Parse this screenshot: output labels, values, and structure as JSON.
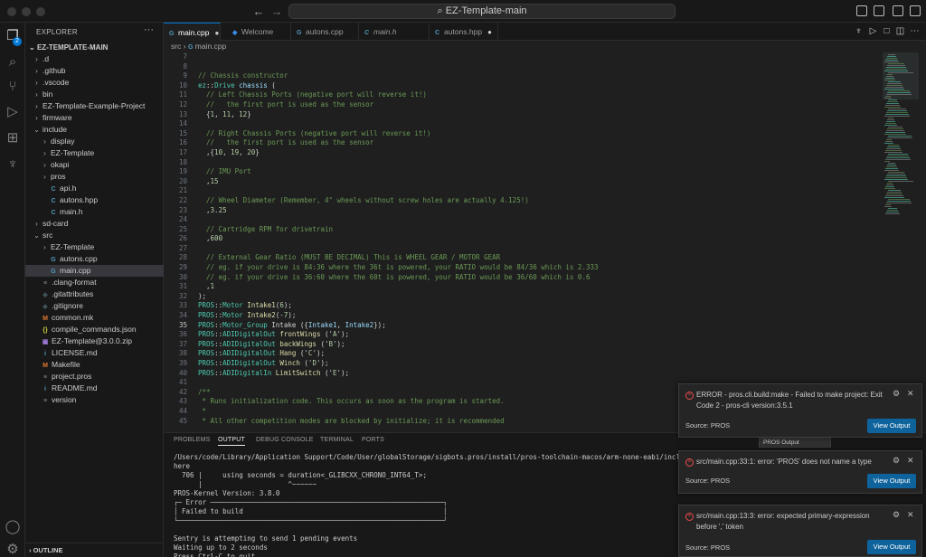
{
  "titlebar": {
    "search": "EZ-Template-main",
    "back": "←",
    "forward": "→"
  },
  "activity": {
    "badge": "2"
  },
  "sidebar": {
    "title": "EXPLORER",
    "more": "···",
    "root": "EZ-TEMPLATE-MAIN",
    "items": [
      {
        "label": ".d",
        "chev": "›",
        "icon": "",
        "depth": 0
      },
      {
        "label": ".github",
        "chev": "›",
        "icon": "",
        "depth": 0
      },
      {
        "label": ".vscode",
        "chev": "›",
        "icon": "",
        "depth": 0
      },
      {
        "label": "bin",
        "chev": "›",
        "icon": "",
        "depth": 0
      },
      {
        "label": "EZ-Template-Example-Project",
        "chev": "›",
        "icon": "",
        "depth": 0
      },
      {
        "label": "firmware",
        "chev": "›",
        "icon": "",
        "depth": 0
      },
      {
        "label": "include",
        "chev": "⌄",
        "icon": "",
        "depth": 0
      },
      {
        "label": "display",
        "chev": "›",
        "icon": "",
        "depth": 1
      },
      {
        "label": "EZ-Template",
        "chev": "›",
        "icon": "",
        "depth": 1
      },
      {
        "label": "okapi",
        "chev": "›",
        "icon": "",
        "depth": 1
      },
      {
        "label": "pros",
        "chev": "›",
        "icon": "",
        "depth": 1
      },
      {
        "label": "api.h",
        "chev": "",
        "icon": "C",
        "depth": 1
      },
      {
        "label": "autons.hpp",
        "chev": "",
        "icon": "C",
        "depth": 1
      },
      {
        "label": "main.h",
        "chev": "",
        "icon": "C",
        "depth": 1
      },
      {
        "label": "sd-card",
        "chev": "›",
        "icon": "",
        "depth": 0
      },
      {
        "label": "src",
        "chev": "⌄",
        "icon": "",
        "depth": 0
      },
      {
        "label": "EZ-Template",
        "chev": "›",
        "icon": "",
        "depth": 1
      },
      {
        "label": "autons.cpp",
        "chev": "",
        "icon": "G",
        "depth": 1
      },
      {
        "label": "main.cpp",
        "chev": "",
        "icon": "G",
        "depth": 1
      },
      {
        "label": ".clang-format",
        "chev": "",
        "icon": "≡",
        "depth": 0
      },
      {
        "label": ".gitattributes",
        "chev": "",
        "icon": "◆",
        "depth": 0
      },
      {
        "label": ".gitignore",
        "chev": "",
        "icon": "◆",
        "depth": 0
      },
      {
        "label": "common.mk",
        "chev": "",
        "icon": "M",
        "depth": 0
      },
      {
        "label": "compile_commands.json",
        "chev": "",
        "icon": "{}",
        "depth": 0
      },
      {
        "label": "EZ-Template@3.0.0.zip",
        "chev": "",
        "icon": "▣",
        "depth": 0
      },
      {
        "label": "LICENSE.md",
        "chev": "",
        "icon": "i",
        "depth": 0
      },
      {
        "label": "Makefile",
        "chev": "",
        "icon": "M",
        "depth": 0
      },
      {
        "label": "project.pros",
        "chev": "",
        "icon": "≡",
        "depth": 0
      },
      {
        "label": "README.md",
        "chev": "",
        "icon": "i",
        "depth": 0
      },
      {
        "label": "version",
        "chev": "",
        "icon": "≡",
        "depth": 0
      }
    ],
    "outline": "OUTLINE"
  },
  "tabs": [
    {
      "label": "main.cpp",
      "icon": "G",
      "dot": "●"
    },
    {
      "label": "Welcome",
      "icon": "◆",
      "dot": ""
    },
    {
      "label": "autons.cpp",
      "icon": "G",
      "dot": ""
    },
    {
      "label": "main.h",
      "icon": "C",
      "dot": ""
    },
    {
      "label": "autons.hpp",
      "icon": "C",
      "dot": "●"
    }
  ],
  "breadcrumb": {
    "folder": "src",
    "sep": "›",
    "file": "main.cpp"
  },
  "editor": {
    "first_line": 7,
    "current_line": 35,
    "lines": [
      [],
      [],
      [
        [
          "c-com",
          "// Chassis constructor"
        ]
      ],
      [
        [
          "c-ns",
          "ez"
        ],
        [
          "",
          "::"
        ],
        [
          "c-ns",
          "Drive"
        ],
        [
          "",
          " "
        ],
        [
          "c-var",
          "chassis"
        ],
        [
          "",
          " ("
        ]
      ],
      [
        [
          "",
          "  "
        ],
        [
          "c-com",
          "// Left Chassis Ports (negative port will reverse it!)"
        ]
      ],
      [
        [
          "",
          "  "
        ],
        [
          "c-com",
          "//   the first port is used as the sensor"
        ]
      ],
      [
        [
          "",
          "  {"
        ],
        [
          "c-num",
          "1"
        ],
        [
          "",
          ", "
        ],
        [
          "c-num",
          "11"
        ],
        [
          "",
          ", "
        ],
        [
          "c-num",
          "12"
        ],
        [
          "",
          "}"
        ]
      ],
      [],
      [
        [
          "",
          "  "
        ],
        [
          "c-com",
          "// Right Chassis Ports (negative port will reverse it!)"
        ]
      ],
      [
        [
          "",
          "  "
        ],
        [
          "c-com",
          "//   the first port is used as the sensor"
        ]
      ],
      [
        [
          "",
          "  ,{"
        ],
        [
          "c-num",
          "10"
        ],
        [
          "",
          ", "
        ],
        [
          "c-num",
          "19"
        ],
        [
          "",
          ", "
        ],
        [
          "c-num",
          "20"
        ],
        [
          "",
          "}"
        ]
      ],
      [],
      [
        [
          "",
          "  "
        ],
        [
          "c-com",
          "// IMU Port"
        ]
      ],
      [
        [
          "",
          "  ,"
        ],
        [
          "c-num",
          "15"
        ]
      ],
      [],
      [
        [
          "",
          "  "
        ],
        [
          "c-com",
          "// Wheel Diameter (Remember, 4\" wheels without screw holes are actually 4.125!)"
        ]
      ],
      [
        [
          "",
          "  ,"
        ],
        [
          "c-num",
          "3.25"
        ]
      ],
      [],
      [
        [
          "",
          "  "
        ],
        [
          "c-com",
          "// Cartridge RPM for drivetrain"
        ]
      ],
      [
        [
          "",
          "  ,"
        ],
        [
          "c-num",
          "600"
        ]
      ],
      [],
      [
        [
          "",
          "  "
        ],
        [
          "c-com",
          "// External Gear Ratio (MUST BE DECIMAL) This is WHEEL GEAR / MOTOR GEAR"
        ]
      ],
      [
        [
          "",
          "  "
        ],
        [
          "c-com",
          "// eg. if your drive is 84:36 where the 36t is powered, your RATIO would be 84/36 which is 2.333"
        ]
      ],
      [
        [
          "",
          "  "
        ],
        [
          "c-com",
          "// eg. if your drive is 36:60 where the 60t is powered, your RATIO would be 36/60 which is 0.6"
        ]
      ],
      [
        [
          "",
          "  ,"
        ],
        [
          "c-num",
          "1"
        ]
      ],
      [
        [
          "",
          ");"
        ]
      ],
      [
        [
          "c-ns",
          "PROS"
        ],
        [
          "",
          "::"
        ],
        [
          "c-ns",
          "Motor"
        ],
        [
          "",
          " "
        ],
        [
          "c-fn",
          "Intake1"
        ],
        [
          "",
          "("
        ],
        [
          "c-num",
          "6"
        ],
        [
          "",
          ");"
        ]
      ],
      [
        [
          "c-ns",
          "PROS"
        ],
        [
          "",
          "::"
        ],
        [
          "c-ns",
          "Motor"
        ],
        [
          "",
          " "
        ],
        [
          "c-fn",
          "Intake2"
        ],
        [
          "",
          "("
        ],
        [
          "c-num",
          "-7"
        ],
        [
          "",
          ");"
        ]
      ],
      [
        [
          "c-ns",
          "PROS"
        ],
        [
          "",
          "::"
        ],
        [
          "c-ns",
          "Motor_Group"
        ],
        [
          "",
          " Intake ({"
        ],
        [
          "c-var",
          "Intake1"
        ],
        [
          "",
          ", "
        ],
        [
          "c-var",
          "Intake2"
        ],
        [
          "",
          "});"
        ]
      ],
      [
        [
          "c-ns",
          "PROS"
        ],
        [
          "",
          "::"
        ],
        [
          "c-ns",
          "ADIDigitalOut"
        ],
        [
          "",
          " "
        ],
        [
          "c-fn",
          "frontWings"
        ],
        [
          "",
          " ('"
        ],
        [
          "c-num",
          "A"
        ],
        [
          "",
          "');"
        ]
      ],
      [
        [
          "c-ns",
          "PROS"
        ],
        [
          "",
          "::"
        ],
        [
          "c-ns",
          "ADIDigitalOut"
        ],
        [
          "",
          " "
        ],
        [
          "c-fn",
          "backWings"
        ],
        [
          "",
          " ('"
        ],
        [
          "c-num",
          "B"
        ],
        [
          "",
          "');"
        ]
      ],
      [
        [
          "c-ns",
          "PROS"
        ],
        [
          "",
          "::"
        ],
        [
          "c-ns",
          "ADIDigitalOut"
        ],
        [
          "",
          " "
        ],
        [
          "c-fn",
          "Hang"
        ],
        [
          "",
          " ('"
        ],
        [
          "c-num",
          "C"
        ],
        [
          "",
          "');"
        ]
      ],
      [
        [
          "c-ns",
          "PROS"
        ],
        [
          "",
          "::"
        ],
        [
          "c-ns",
          "ADIDigitalOut"
        ],
        [
          "",
          " "
        ],
        [
          "c-fn",
          "Winch"
        ],
        [
          "",
          " ('"
        ],
        [
          "c-num",
          "D"
        ],
        [
          "",
          "');"
        ]
      ],
      [
        [
          "c-ns",
          "PROS"
        ],
        [
          "",
          "::"
        ],
        [
          "c-ns",
          "ADIDigitalIn"
        ],
        [
          "",
          " "
        ],
        [
          "c-fn",
          "LimitSwitch"
        ],
        [
          "",
          " ('"
        ],
        [
          "c-num",
          "E"
        ],
        [
          "",
          "');"
        ]
      ],
      [],
      [
        [
          "c-com",
          "/**"
        ]
      ],
      [
        [
          "c-com",
          " * Runs initialization code. This occurs as soon as the program is started."
        ]
      ],
      [
        [
          "c-com",
          " *"
        ]
      ],
      [
        [
          "c-com",
          " * All other competition modes are blocked by initialize; it is recommended"
        ]
      ]
    ]
  },
  "panel": {
    "tabs": [
      "PROBLEMS",
      "OUTPUT",
      "DEBUG CONSOLE",
      "TERMINAL",
      "PORTS"
    ],
    "active_tab": "OUTPUT",
    "select": "PROS Output",
    "lines": [
      "/Users/code/Library/Application Support/Code/User/globalStorage/sigbots.pros/install/pros-toolchain-macos/arm-none-eabi/include/c++",
      "here",
      "  706 |     using seconds = duration<_GLIBCXX_CHRONO_INT64_T>;",
      "      |                     ^~~~~~~",
      "PROS-Kernel Version: 3.8.0",
      "┌─ Error ─────────────────────────────────────────────────────────┐",
      "│ Failed to build                                                 │",
      "└─────────────────────────────────────────────────────────────────┘",
      "",
      "Sentry is attempting to send 1 pending events",
      "Waiting up to 2 seconds",
      "Press Ctrl-C to quit"
    ]
  },
  "notifications": [
    {
      "message": "ERROR - pros.cli.build:make - Failed to make project: Exit Code 2 - pros-cli version:3.5.1",
      "source": "Source: PROS",
      "button": "View Output"
    },
    {
      "message": "src/main.cpp:33:1: error: 'PROS' does not name a type",
      "source": "Source: PROS",
      "button": "View Output"
    },
    {
      "message": "src/main.cpp:13:3: error: expected primary-expression before ',' token",
      "source": "Source: PROS",
      "button": "View Output"
    }
  ],
  "colors": {
    "accent": "#0078d4",
    "button": "#0e639c",
    "error": "#f14c4c",
    "comment": "#6a9955",
    "type": "#4ec9b0"
  }
}
